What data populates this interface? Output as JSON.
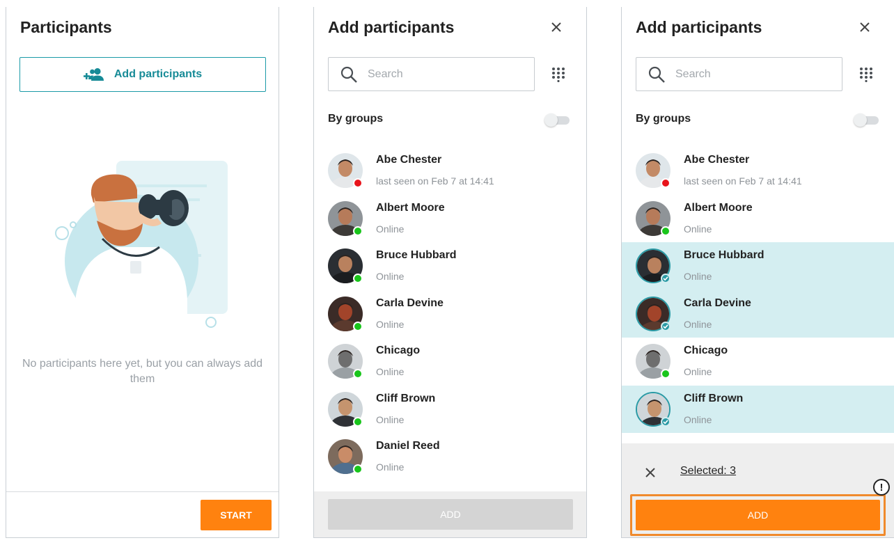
{
  "panel_empty": {
    "title": "Participants",
    "add_button_label": "Add participants",
    "empty_message": "No participants here yet, but you can always add them",
    "start_button_label": "START"
  },
  "panel_picker": {
    "title": "Add participants",
    "search_placeholder": "Search",
    "by_groups_label": "By groups",
    "by_groups_enabled": false,
    "contacts": [
      {
        "name": "Abe Chester",
        "status": "last seen on Feb 7 at 14:41",
        "presence": "away",
        "avatar_colors": [
          "#dfe6ea",
          "#c38a66",
          "#e6e8ea"
        ]
      },
      {
        "name": "Albert Moore",
        "status": "Online",
        "presence": "online",
        "avatar_colors": [
          "#8f9498",
          "#b67b5a",
          "#3d3a37"
        ]
      },
      {
        "name": "Bruce Hubbard",
        "status": "Online",
        "presence": "online",
        "avatar_colors": [
          "#2a2e33",
          "#b9815e",
          "#1b1d20"
        ]
      },
      {
        "name": "Carla Devine",
        "status": "Online",
        "presence": "online",
        "avatar_colors": [
          "#3b2b27",
          "#a2442a",
          "#5b3a2e"
        ]
      },
      {
        "name": "Chicago",
        "status": "Online",
        "presence": "online",
        "avatar_colors": [
          "#cfd3d6",
          "#6e6e6e",
          "#9aa0a4"
        ]
      },
      {
        "name": "Cliff Brown",
        "status": "Online",
        "presence": "online",
        "avatar_colors": [
          "#cfd6da",
          "#c5946e",
          "#2f3236"
        ]
      },
      {
        "name": "Daniel Reed",
        "status": "Online",
        "presence": "online",
        "avatar_colors": [
          "#7d6b5d",
          "#c98c68",
          "#4f6f8f"
        ]
      }
    ],
    "add_button_label": "ADD"
  },
  "panel_selected": {
    "title": "Add participants",
    "search_placeholder": "Search",
    "by_groups_label": "By groups",
    "selected_label": "Selected: 3",
    "add_button_label": "ADD",
    "warning_glyph": "!",
    "selected_names": [
      "Bruce Hubbard",
      "Carla Devine",
      "Cliff Brown"
    ]
  },
  "colors": {
    "accent_teal": "#1a9aa7",
    "accent_orange": "#ff820f",
    "selected_row": "#d4eef1",
    "online": "#19c51b",
    "away": "#e8141b"
  }
}
